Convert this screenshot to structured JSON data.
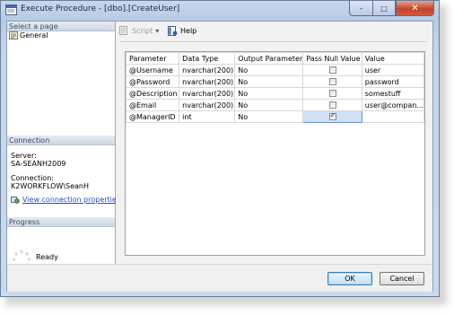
{
  "window": {
    "title": "Execute Procedure - [dbo].[CreateUser]",
    "controls": {
      "minimize": "–",
      "maximize": "□",
      "close": "✕"
    }
  },
  "left_pane": {
    "select_page_header": "Select a page",
    "pages": [
      {
        "label": "General",
        "icon": "general-page-icon"
      }
    ],
    "connection_header": "Connection",
    "server_label": "Server:",
    "server_value": "SA-SEANH2009",
    "connection_label": "Connection:",
    "connection_value": "K2WORKFLOW\\SeanH",
    "view_connection_link": "View connection properties",
    "progress_header": "Progress",
    "progress_status": "Ready"
  },
  "toolbar": {
    "script_label": "Script",
    "script_dropdown": "▾",
    "help_label": "Help"
  },
  "grid": {
    "columns": [
      "Parameter",
      "Data Type",
      "Output Parameter",
      "Pass Null Value",
      "Value"
    ],
    "rows": [
      {
        "parameter": "@Username",
        "data_type": "nvarchar(200)",
        "output": "No",
        "pass_null": false,
        "value": "user"
      },
      {
        "parameter": "@Password",
        "data_type": "nvarchar(200)",
        "output": "No",
        "pass_null": false,
        "value": "password"
      },
      {
        "parameter": "@Description",
        "data_type": "nvarchar(200)",
        "output": "No",
        "pass_null": false,
        "value": "somestuff"
      },
      {
        "parameter": "@Email",
        "data_type": "nvarchar(200)",
        "output": "No",
        "pass_null": false,
        "value": "user@compan..."
      },
      {
        "parameter": "@ManagerID",
        "data_type": "int",
        "output": "No",
        "pass_null": true,
        "value": ""
      }
    ],
    "selected_row": 4
  },
  "buttons": {
    "ok": "OK",
    "cancel": "Cancel"
  },
  "colors": {
    "link": "#1f4ecf",
    "close_button": "#c6452c",
    "selection": "#cfe0f7"
  }
}
